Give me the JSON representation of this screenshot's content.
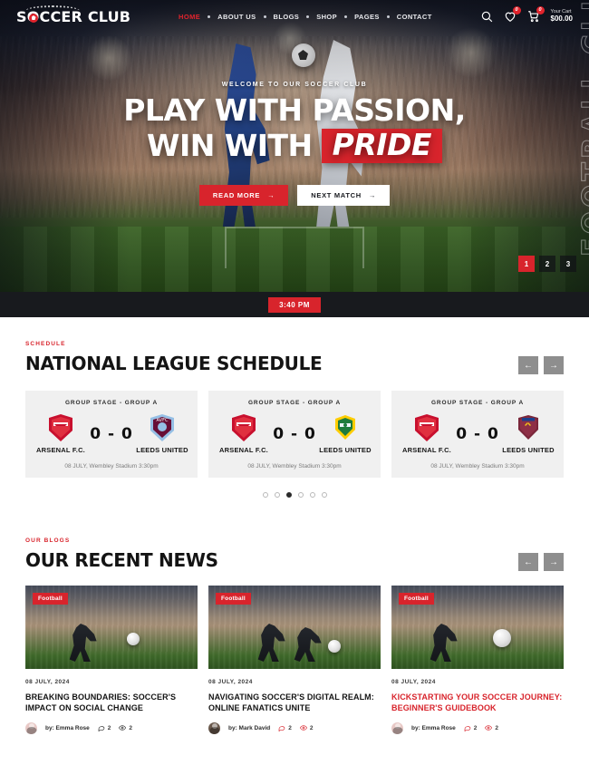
{
  "header": {
    "logo_text": "SOCCER CLUB",
    "nav": [
      {
        "label": "HOME",
        "active": true
      },
      {
        "label": "ABOUT US",
        "active": false
      },
      {
        "label": "BLOGS",
        "active": false
      },
      {
        "label": "SHOP",
        "active": false
      },
      {
        "label": "PAGES",
        "active": false
      },
      {
        "label": "CONTACT",
        "active": false
      }
    ],
    "search_icon": "search-icon",
    "wishlist_icon": "heart-icon",
    "wishlist_count": "0",
    "cart_icon": "cart-icon",
    "cart_count": "0",
    "cart_label": "Your Cart",
    "cart_total": "$00.00"
  },
  "hero": {
    "kicker": "WELCOME TO OUR SOCCER CLUB",
    "title_line1": "PLAY WITH PASSION,",
    "title_line2_prefix": "WIN WITH",
    "title_highlight": "PRIDE",
    "btn_primary": "READ MORE",
    "btn_secondary": "NEXT MATCH",
    "arrow_glyph": "→",
    "vertical_text": "FOOTBALL CLUB",
    "pagination": [
      "1",
      "2",
      "3"
    ],
    "active_page": "1",
    "time_badge": "3:40 PM"
  },
  "schedule": {
    "kicker": "SCHEDULE",
    "title": "NATIONAL LEAGUE SCHEDULE",
    "prev_arrow": "←",
    "next_arrow": "→",
    "matches": [
      {
        "stage": "GROUP STAGE - GROUP A",
        "home_team": "ARSENAL F.C.",
        "away_team": "LEEDS UNITED",
        "home_crest": "arsenal-crest",
        "away_crest": "aston-villa-crest",
        "score": "0 - 0",
        "meta": "08 JULY, Wembley Stadium 3:30pm"
      },
      {
        "stage": "GROUP STAGE - GROUP A",
        "home_team": "ARSENAL F.C.",
        "away_team": "LEEDS UNITED",
        "home_crest": "arsenal-crest",
        "away_crest": "leeds-crest",
        "score": "0 - 0",
        "meta": "08 JULY, Wembley Stadium 3:30pm"
      },
      {
        "stage": "GROUP STAGE - GROUP A",
        "home_team": "ARSENAL F.C.",
        "away_team": "LEEDS UNITED",
        "home_crest": "arsenal-crest",
        "away_crest": "westham-crest",
        "score": "0 - 0",
        "meta": "08 JULY, Wembley Stadium 3:30pm"
      }
    ],
    "dots_count": 6,
    "active_dot": 3
  },
  "blogs": {
    "kicker": "OUR BLOGS",
    "title": "OUR RECENT NEWS",
    "prev_arrow": "←",
    "next_arrow": "→",
    "posts": [
      {
        "tag": "Football",
        "date": "08 JULY, 2024",
        "title": "BREAKING BOUNDARIES: SOCCER'S IMPACT ON SOCIAL CHANGE",
        "title_red": false,
        "author": "by: Emma Rose",
        "comments": "2",
        "views": "2",
        "comment_icon": "comment-icon",
        "view_icon": "eye-icon"
      },
      {
        "tag": "Football",
        "date": "08 JULY, 2024",
        "title": "NAVIGATING SOCCER'S DIGITAL REALM: ONLINE FANATICS UNITE",
        "title_red": false,
        "author": "by: Mark David",
        "comments": "2",
        "views": "2",
        "comment_icon": "comment-icon",
        "view_icon": "eye-icon"
      },
      {
        "tag": "Football",
        "date": "08 JULY, 2024",
        "title": "KICKSTARTING YOUR SOCCER JOURNEY: BEGINNER'S GUIDEBOOK",
        "title_red": true,
        "author": "by: Emma Rose",
        "comments": "2",
        "views": "2",
        "comment_icon": "comment-icon",
        "view_icon": "eye-icon"
      }
    ]
  },
  "colors": {
    "accent_red": "#d8242c",
    "dark": "#181a1e",
    "card_gray": "#f0f0f0",
    "arrow_gray": "#8e8e8e"
  }
}
